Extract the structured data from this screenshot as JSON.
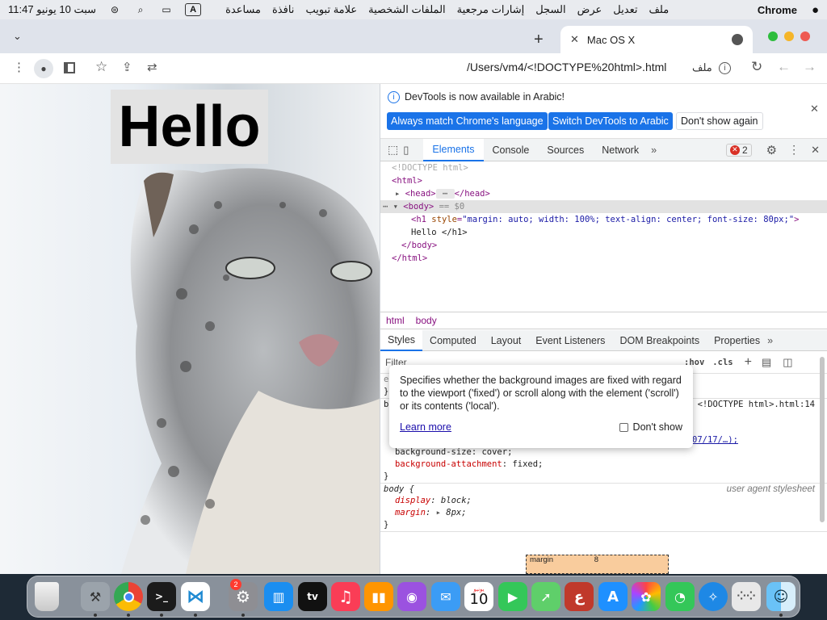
{
  "menubar": {
    "app": "Chrome",
    "items": [
      "ملف",
      "تعديل",
      "عرض",
      "السجل",
      "إشارات مرجعية",
      "الملفات الشخصية",
      "علامة تبويب",
      "نافذة",
      "مساعدة"
    ],
    "clock": "سبت 10 يونيو  11:47",
    "input_source": "A"
  },
  "tab": {
    "title": "Mac OS X"
  },
  "toolbar": {
    "url": "/Users/vm4/<!DOCTYPE%20html>.html",
    "file_label": "ملف"
  },
  "page": {
    "heading": "Hello"
  },
  "devtools": {
    "infobar": {
      "message": "DevTools is now available in Arabic!",
      "btn_match": "Always match Chrome's language",
      "btn_switch": "Switch DevTools to Arabic",
      "btn_dont": "Don't show again"
    },
    "tabs": [
      "Elements",
      "Console",
      "Sources",
      "Network"
    ],
    "error_count": "2",
    "dom": {
      "doctype": "<!DOCTYPE html>",
      "html_open": "<html>",
      "head": "<head>",
      "head_close": "</head>",
      "body_open": "<body>",
      "selected_marker": "== $0",
      "h1_tag": "<h1 ",
      "h1_attr": "style",
      "h1_val": "\"margin: auto; width: 100%; text-align: center; font-size: 80px;\"",
      "h1_text": "Hello </h1>",
      "body_close": "</body>",
      "html_close": "</html>"
    },
    "breadcrumbs": [
      "html",
      "body"
    ],
    "style_tabs": [
      "Styles",
      "Computed",
      "Layout",
      "Event Listeners",
      "DOM Breakpoints",
      "Properties"
    ],
    "filter_placeholder": "Filter",
    "hov": ":hov",
    "cls": ".cls",
    "styles": {
      "element_style": "element.style {",
      "rule_source": "<!DOCTYPE html>.html:14",
      "url_frag": "07/17/…);",
      "bg_size": "background-size: cover;",
      "bg_attach_prop": "background-attachment",
      "bg_attach_val": "fixed;",
      "body_sel": "body {",
      "ua_label": "user agent stylesheet",
      "display_prop": "display",
      "display_val": "block;",
      "margin_prop": "margin",
      "margin_val": "8px;"
    },
    "tooltip": {
      "text": "Specifies whether the background images are fixed with regard to the viewport ('fixed') or scroll along with the element ('scroll') or its contents ('local').",
      "learn_more": "Learn more",
      "dont_show": "Don't show"
    },
    "box_model": {
      "label": "margin",
      "value": "8"
    }
  },
  "dock": {
    "calendar_month": "يونيو",
    "calendar_day": "10",
    "settings_badge": "2",
    "apps": [
      "trash",
      "utility",
      "chrome",
      "terminal",
      "vscode",
      "system-settings",
      "keynote",
      "apple-tv",
      "music",
      "books",
      "podcasts",
      "mail",
      "calendar",
      "facetime",
      "maps",
      "arabic-dict",
      "app-store",
      "photos",
      "messages",
      "safari",
      "launchpad",
      "finder"
    ]
  }
}
